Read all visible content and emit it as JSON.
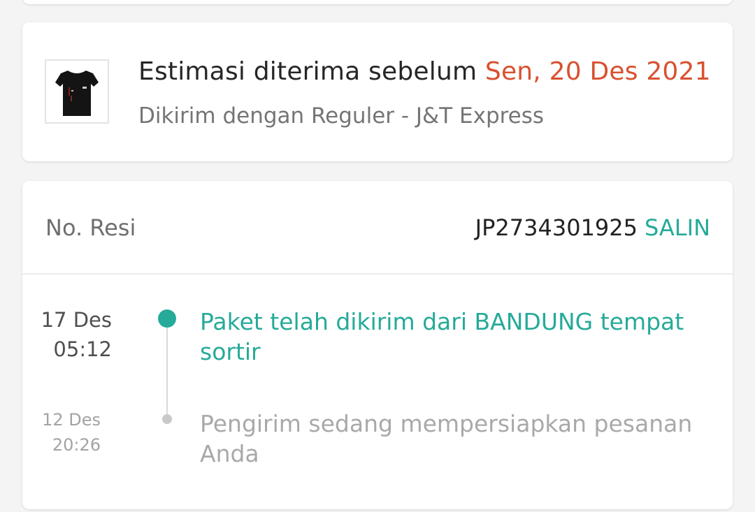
{
  "colors": {
    "accent": "#26aa99",
    "date_highlight": "#d8512f",
    "background": "#f4f4f4"
  },
  "delivery": {
    "product_image": "black-tshirt-thumbnail",
    "estimate_label": "Estimasi diterima sebelum",
    "estimate_date": "Sen, 20 Des 2021",
    "courier": "Dikirim dengan Reguler - J&T Express"
  },
  "tracking": {
    "resi_label": "No. Resi",
    "resi_number": "JP2734301925",
    "copy_label": "SALIN",
    "events": [
      {
        "date": "17 Des",
        "time": "05:12",
        "description": "Paket telah dikirim dari BANDUNG tempat sortir"
      },
      {
        "date": "12 Des",
        "time": "20:26",
        "description": "Pengirim sedang mempersiapkan pesanan Anda"
      }
    ]
  }
}
